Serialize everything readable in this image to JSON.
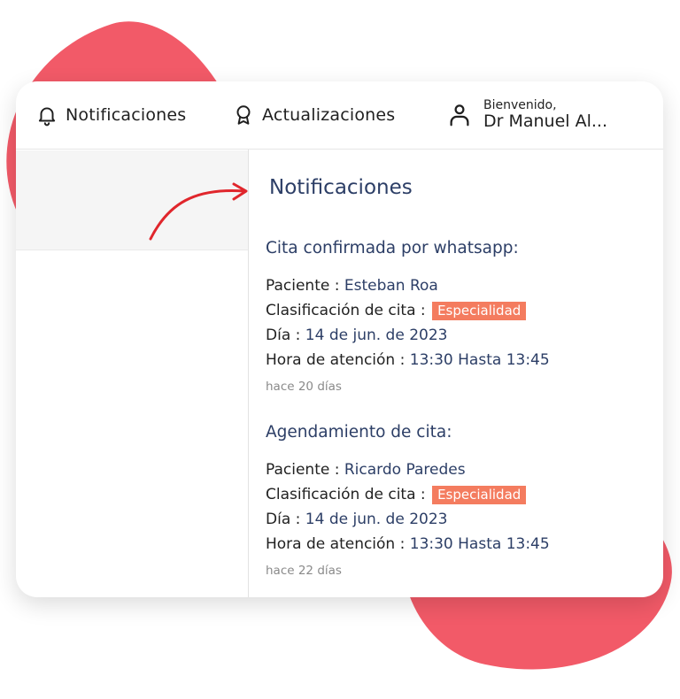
{
  "colors": {
    "blob": "#f25a68",
    "accent_text": "#2c3e66",
    "badge": "#f47c5f",
    "arrow": "#e0262c"
  },
  "topbar": {
    "notifications": {
      "icon": "bell-icon",
      "label": "Notificaciones"
    },
    "updates": {
      "icon": "award-ribbon-icon",
      "label": "Actualizaciones"
    },
    "user": {
      "icon": "user-icon",
      "greeting": "Bienvenido,",
      "name": "Dr Manuel Al..."
    }
  },
  "panel": {
    "title": "Notificaciones",
    "notifications": [
      {
        "title": "Cita confirmada por whatsapp:",
        "patient_label": "Paciente : ",
        "patient": "Esteban Roa",
        "class_label": "Clasificación de cita : ",
        "class": "Especialidad",
        "day_label": "Día : ",
        "day": "14 de jun. de 2023",
        "time_label": "Hora de atención : ",
        "time": "13:30 Hasta 13:45",
        "ago": "hace 20 días"
      },
      {
        "title": "Agendamiento de cita:",
        "patient_label": "Paciente : ",
        "patient": "Ricardo Paredes",
        "class_label": "Clasificación de cita : ",
        "class": "Especialidad",
        "day_label": "Día : ",
        "day": "14 de jun. de 2023",
        "time_label": "Hora de atención : ",
        "time": "13:30 Hasta 13:45",
        "ago": "hace 22 días"
      }
    ]
  }
}
